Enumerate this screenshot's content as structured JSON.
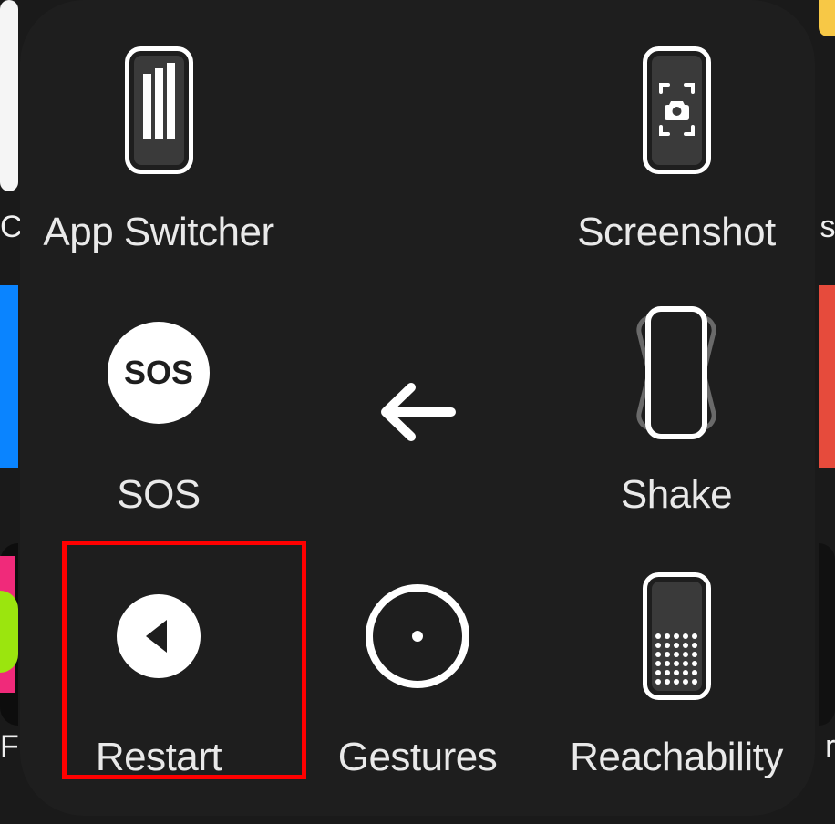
{
  "menu": {
    "items": [
      {
        "id": "app-switcher",
        "label": "App Switcher",
        "icon": "app-switcher-icon"
      },
      {
        "id": "back",
        "label": "",
        "icon": "arrow-left-icon"
      },
      {
        "id": "screenshot",
        "label": "Screenshot",
        "icon": "screenshot-icon"
      },
      {
        "id": "sos",
        "label": "SOS",
        "icon": "sos-icon"
      },
      {
        "id": "center",
        "label": "",
        "icon": ""
      },
      {
        "id": "shake",
        "label": "Shake",
        "icon": "shake-icon"
      },
      {
        "id": "restart",
        "label": "Restart",
        "icon": "restart-icon",
        "highlighted": true
      },
      {
        "id": "gestures",
        "label": "Gestures",
        "icon": "gestures-icon"
      },
      {
        "id": "reachability",
        "label": "Reachability",
        "icon": "reachability-icon"
      }
    ]
  },
  "background": {
    "partial_labels": [
      "C",
      "Fi",
      "s",
      "r"
    ]
  },
  "colors": {
    "panel": "#1e1e1e",
    "text": "#e9e9e9",
    "highlight": "#ff0000"
  }
}
